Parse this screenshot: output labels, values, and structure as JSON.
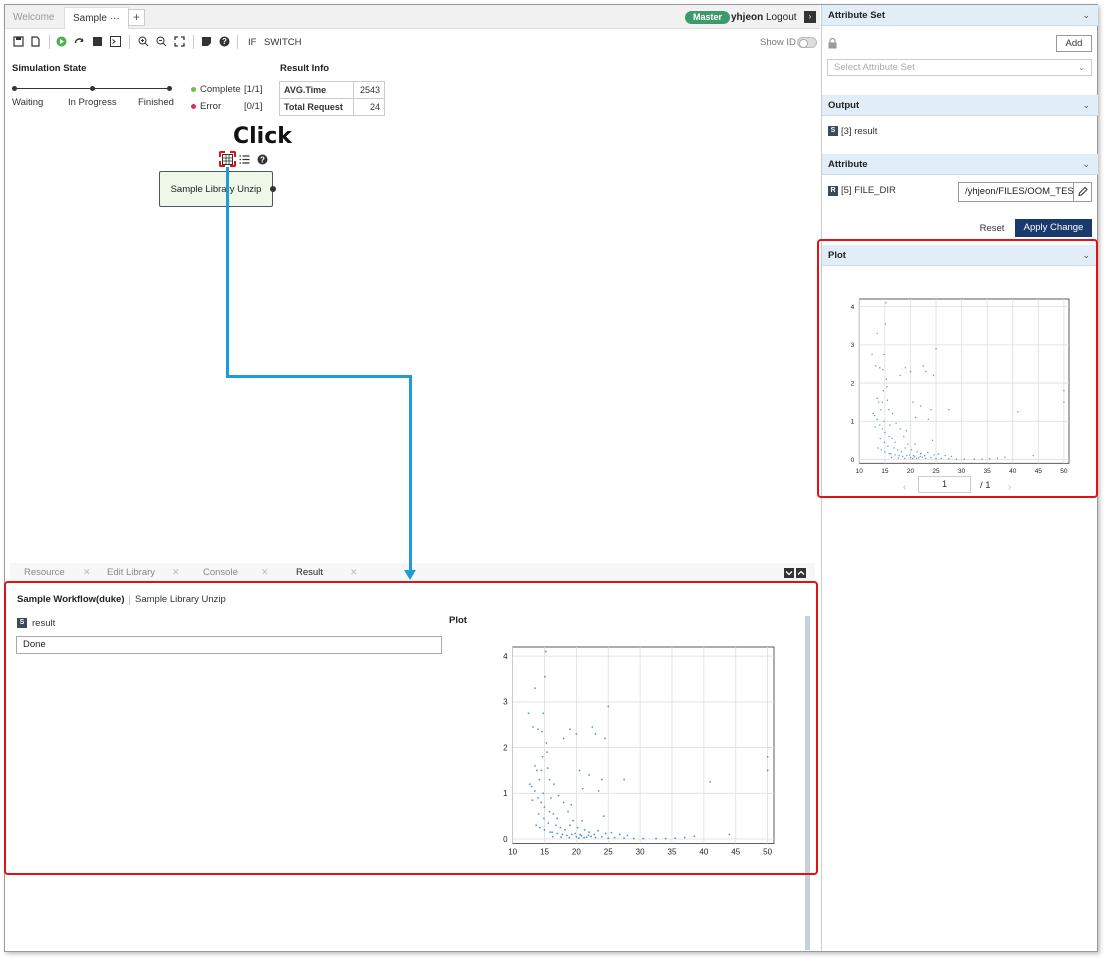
{
  "tabs": [
    {
      "label": "Welcome",
      "active": false
    },
    {
      "label": "Sample ···",
      "active": true
    }
  ],
  "add_tab_label": "+",
  "header": {
    "master_label": "Master",
    "username": "yhjeon",
    "logout_label": "Logout",
    "expand_icon": "›"
  },
  "toolbar": {
    "if_label": "IF",
    "switch_label": "SWITCH",
    "show_id_label": "Show ID"
  },
  "simulation_state": {
    "title": "Simulation State",
    "steps": [
      "Waiting",
      "In Progress",
      "Finished"
    ],
    "complete_label": "Complete",
    "complete_count": "[1/1]",
    "error_label": "Error",
    "error_count": "[0/1]",
    "status_colors": {
      "complete": "#6cc04a",
      "error": "#e0334a"
    }
  },
  "result_info": {
    "title": "Result Info",
    "rows": [
      {
        "key": "AVG.Time",
        "value": "2543"
      },
      {
        "key": "Total Request",
        "value": "24"
      }
    ]
  },
  "canvas": {
    "click_annotation": "Click",
    "node_label": "Sample Library Unzip"
  },
  "bottom_tabs": [
    {
      "label": "Resource",
      "close": "✕"
    },
    {
      "label": "Edit Library",
      "close": "✕"
    },
    {
      "label": "Console",
      "close": "✕"
    },
    {
      "label": "Result",
      "close": "✕"
    }
  ],
  "result_panel": {
    "breadcrumb_workflow": "Sample Workflow(duke)",
    "breadcrumb_library": "Sample Library Unzip",
    "output_badge": "S",
    "output_name": "result",
    "output_value": "Done",
    "plot_title": "Plot"
  },
  "right_panel": {
    "attribute_set_title": "Attribute Set",
    "add_label": "Add",
    "select_placeholder": "Select Attribute Set",
    "output_title": "Output",
    "output_badge": "S",
    "output_item": "[3] result",
    "attribute_title": "Attribute",
    "attribute_badge": "R",
    "attribute_item": "[5] FILE_DIR",
    "attribute_value": "/yhjeon/FILES/OOM_TES",
    "reset_label": "Reset",
    "apply_label": "Apply Change",
    "plot_title": "Plot",
    "pager_current": "1",
    "pager_total": "/ 1",
    "pager_prev": "‹",
    "pager_next": "›"
  },
  "accent_colors": {
    "primary": "#1a3a6e",
    "header_band": "#e1eef8",
    "annotation_red": "#e01212",
    "arrow_blue": "#1f9bd7"
  },
  "chart_data": {
    "type": "scatter",
    "xlim": [
      10,
      51
    ],
    "ylim": [
      -0.1,
      4.2
    ],
    "xticks": [
      10,
      15,
      20,
      25,
      30,
      35,
      40,
      45,
      50
    ],
    "yticks": [
      0,
      1,
      2,
      3,
      4
    ],
    "grid": true,
    "point_color": "#3b7fc4",
    "points": [
      [
        12.5,
        2.75
      ],
      [
        13.5,
        3.3
      ],
      [
        13.2,
        2.45
      ],
      [
        14,
        2.4
      ],
      [
        14.6,
        2.35
      ],
      [
        15.2,
        4.1
      ],
      [
        15.1,
        3.55
      ],
      [
        14.8,
        2.75
      ],
      [
        15.3,
        2.1
      ],
      [
        13.5,
        1.6
      ],
      [
        13.8,
        1.5
      ],
      [
        14.2,
        1.3
      ],
      [
        14.5,
        1.5
      ],
      [
        13.0,
        1.15
      ],
      [
        13.5,
        1.05
      ],
      [
        14.8,
        1.0
      ],
      [
        15.5,
        1.55
      ],
      [
        15.8,
        1.3
      ],
      [
        14.0,
        0.9
      ],
      [
        14.5,
        0.8
      ],
      [
        15.0,
        0.7
      ],
      [
        15.8,
        0.6
      ],
      [
        16.4,
        0.55
      ],
      [
        17.0,
        0.45
      ],
      [
        13.7,
        0.3
      ],
      [
        14.3,
        0.25
      ],
      [
        15.0,
        0.2
      ],
      [
        16.2,
        0.15
      ],
      [
        17.0,
        0.12
      ],
      [
        17.8,
        0.1
      ],
      [
        18.5,
        0.08
      ],
      [
        19.3,
        0.1
      ],
      [
        20.0,
        0.05
      ],
      [
        20.8,
        0.07
      ],
      [
        21.6,
        0.04
      ],
      [
        22.3,
        0.06
      ],
      [
        23.0,
        0.03
      ],
      [
        24.0,
        0.05
      ],
      [
        25.0,
        0.02
      ],
      [
        26.0,
        0.03
      ],
      [
        27.5,
        0.02
      ],
      [
        29.0,
        0.01
      ],
      [
        30.5,
        0.01
      ],
      [
        32.5,
        0.01
      ],
      [
        34.0,
        0.01
      ],
      [
        35.5,
        0.02
      ],
      [
        37.0,
        0.03
      ],
      [
        38.5,
        0.06
      ],
      [
        16.0,
        0.9
      ],
      [
        16.5,
        1.2
      ],
      [
        17.2,
        0.95
      ],
      [
        18.0,
        0.8
      ],
      [
        18.7,
        0.6
      ],
      [
        19.5,
        0.4
      ],
      [
        18.0,
        2.2
      ],
      [
        19.0,
        2.4
      ],
      [
        20.0,
        2.3
      ],
      [
        20.5,
        1.5
      ],
      [
        21.0,
        1.1
      ],
      [
        22.0,
        1.4
      ],
      [
        22.5,
        2.45
      ],
      [
        23.0,
        2.3
      ],
      [
        24.0,
        1.3
      ],
      [
        24.5,
        2.2
      ],
      [
        23.5,
        1.05
      ],
      [
        24.3,
        0.5
      ],
      [
        25.0,
        2.9
      ],
      [
        27.5,
        1.3
      ],
      [
        41.0,
        1.25
      ],
      [
        50.0,
        1.8
      ],
      [
        50.0,
        1.5
      ],
      [
        44.0,
        0.1
      ],
      [
        19.0,
        0.3
      ],
      [
        20.2,
        0.25
      ],
      [
        21.3,
        0.2
      ],
      [
        22.0,
        0.15
      ],
      [
        23.4,
        0.18
      ],
      [
        24.6,
        0.12
      ],
      [
        25.5,
        0.14
      ],
      [
        26.8,
        0.1
      ],
      [
        28.0,
        0.08
      ],
      [
        16.8,
        0.3
      ],
      [
        17.5,
        0.25
      ],
      [
        18.2,
        0.2
      ],
      [
        19.8,
        0.12
      ],
      [
        20.6,
        0.1
      ],
      [
        21.9,
        0.08
      ],
      [
        22.8,
        0.1
      ],
      [
        16.3,
        0.05
      ],
      [
        17.6,
        0.04
      ],
      [
        18.9,
        0.03
      ],
      [
        20.4,
        0.02
      ],
      [
        21.2,
        0.03
      ],
      [
        15.6,
        0.35
      ],
      [
        15.9,
        0.15
      ],
      [
        14.9,
        0.45
      ],
      [
        14.1,
        0.55
      ],
      [
        14.7,
        1.8
      ],
      [
        15.4,
        1.9
      ],
      [
        12.7,
        1.2
      ],
      [
        13.1,
        0.85
      ],
      [
        19.2,
        0.75
      ],
      [
        20.9,
        0.4
      ]
    ]
  }
}
